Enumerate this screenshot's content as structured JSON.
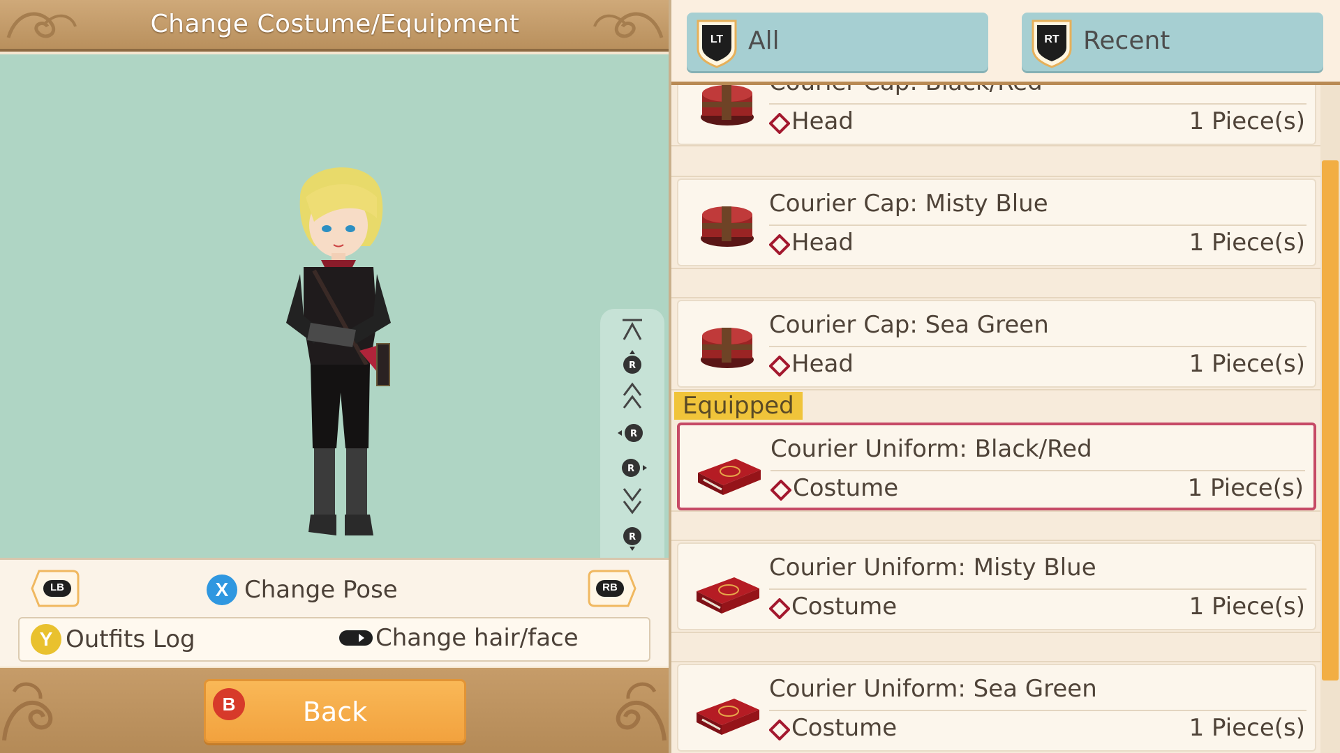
{
  "header": {
    "title": "Change Costume/Equipment"
  },
  "controls": {
    "lb_label": "LB",
    "rb_label": "RB",
    "change_pose_button": "X",
    "change_pose_label": "Change Pose",
    "outfits_log_button": "Y",
    "outfits_log_label": "Outfits Log",
    "change_hair_label": "Change hair/face",
    "stick_button": "R"
  },
  "footer": {
    "back_button": "B",
    "back_label": "Back"
  },
  "filters": {
    "all_trigger": "LT",
    "all_label": "All",
    "recent_trigger": "RT",
    "recent_label": "Recent"
  },
  "equipped_tag": "Equipped",
  "items": [
    {
      "name": "Courier Cap: Black/Red",
      "category": "Head",
      "quantity": "1 Piece(s)",
      "icon": "hat-icon"
    },
    {
      "name": "Courier Cap: Misty Blue",
      "category": "Head",
      "quantity": "1 Piece(s)",
      "icon": "hat-icon"
    },
    {
      "name": "Courier Cap: Sea Green",
      "category": "Head",
      "quantity": "1 Piece(s)",
      "icon": "hat-icon"
    },
    {
      "name": "Courier Uniform: Black/Red",
      "category": "Costume",
      "quantity": "1 Piece(s)",
      "icon": "costume-box-icon",
      "equipped": true
    },
    {
      "name": "Courier Uniform: Misty Blue",
      "category": "Costume",
      "quantity": "1 Piece(s)",
      "icon": "costume-box-icon"
    },
    {
      "name": "Courier Uniform: Sea Green",
      "category": "Costume",
      "quantity": "1 Piece(s)",
      "icon": "costume-box-icon"
    }
  ],
  "colors": {
    "preview_bg": "#afd5c4",
    "filter_tab": "#a6cfd2",
    "back_button": "#f5ab48",
    "equipped_border": "#c64a66",
    "equipped_tag": "#f0c43a",
    "scroll_thumb": "#f2ae43"
  }
}
